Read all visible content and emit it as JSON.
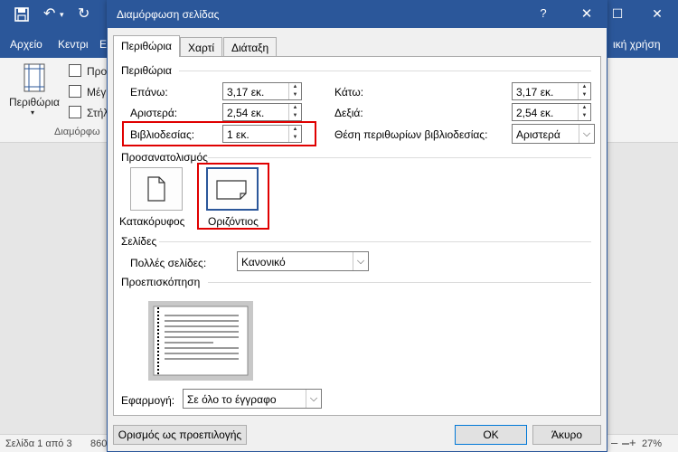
{
  "word": {
    "ribbon_tabs": [
      "Αρχείο",
      "Κεντρι",
      "Ε",
      "ική χρήση"
    ],
    "ribbon_labels": {
      "margins": "Περιθώρια",
      "group": "Διαμόρφω",
      "item1": "Προ",
      "item2": "Μέγ",
      "item3": "Στήλ"
    },
    "status": {
      "page": "Σελίδα 1 από 3",
      "words": "860",
      "zoom": "27%"
    }
  },
  "dialog": {
    "title": "Διαμόρφωση σελίδας",
    "help": "?",
    "close": "✕",
    "tabs": [
      "Περιθώρια",
      "Χαρτί",
      "Διάταξη"
    ],
    "margins_section": "Περιθώρια",
    "fields": {
      "top_label": "Επάνω:",
      "top_value": "3,17 εκ.",
      "bottom_label": "Κάτω:",
      "bottom_value": "3,17 εκ.",
      "left_label": "Αριστερά:",
      "left_value": "2,54 εκ.",
      "right_label": "Δεξιά:",
      "right_value": "2,54 εκ.",
      "gutter_label": "Βιβλιοδεσίας:",
      "gutter_value": "1 εκ.",
      "gutter_pos_label": "Θέση περιθωρίων βιβλιοδεσίας:",
      "gutter_pos_value": "Αριστερά"
    },
    "orientation_section": "Προσανατολισμός",
    "portrait": "Κατακόρυφος",
    "landscape": "Οριζόντιος",
    "pages_section": "Σελίδες",
    "multiple_pages_label": "Πολλές σελίδες:",
    "multiple_pages_value": "Κανονικό",
    "preview_section": "Προεπισκόπηση",
    "apply_label": "Εφαρμογή:",
    "apply_value": "Σε όλο το έγγραφο",
    "default_button": "Ορισμός ως προεπιλογής",
    "ok_button": "OK",
    "cancel_button": "Άκυρο"
  },
  "colors": {
    "title_blue": "#2b579a",
    "highlight_red": "#e00000"
  }
}
